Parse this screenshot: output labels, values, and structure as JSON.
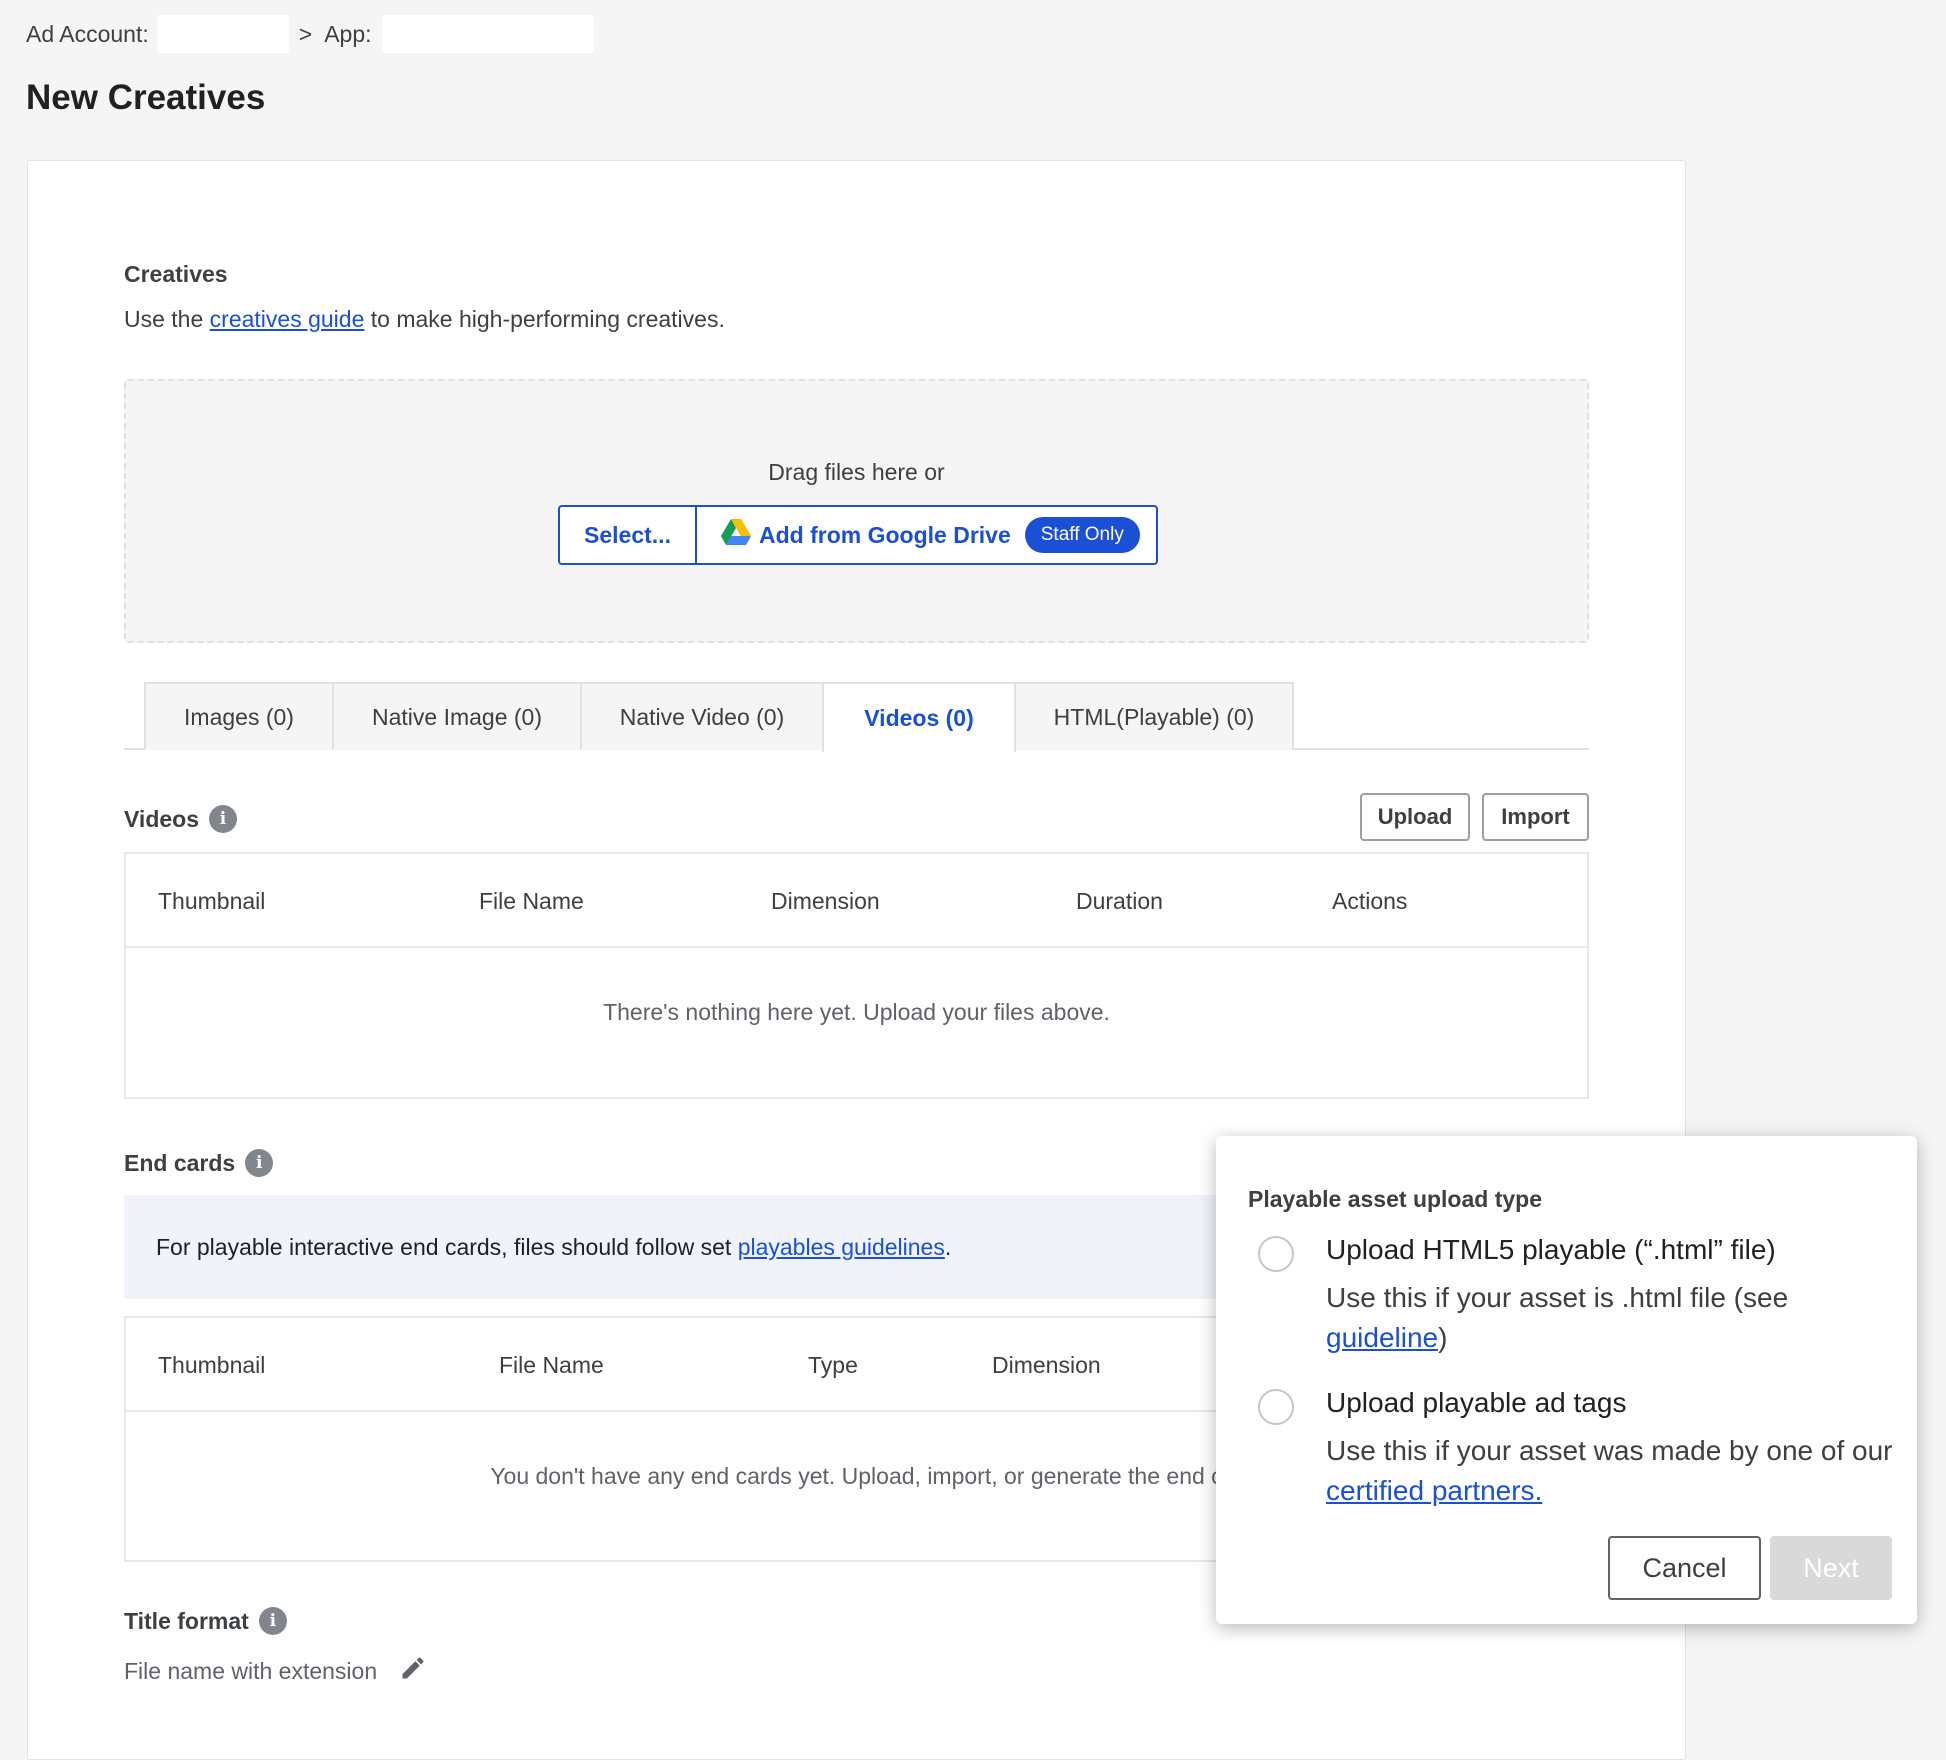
{
  "breadcrumb": {
    "ad_account_label": "Ad Account:",
    "separator": ">",
    "app_label": "App:"
  },
  "page_title": "New Creatives",
  "creatives": {
    "section_title": "Creatives",
    "helper_prefix": "Use the ",
    "helper_link": "creatives guide",
    "helper_suffix": " to make high-performing creatives."
  },
  "dropzone": {
    "text": "Drag files here or",
    "select_label": "Select...",
    "drive_label": "Add from Google Drive",
    "staff_badge": "Staff Only"
  },
  "tabs": [
    {
      "label": "Images (0)",
      "active": false
    },
    {
      "label": "Native Image (0)",
      "active": false
    },
    {
      "label": "Native Video (0)",
      "active": false
    },
    {
      "label": "Videos (0)",
      "active": true
    },
    {
      "label": "HTML(Playable) (0)",
      "active": false
    }
  ],
  "videos": {
    "title": "Videos",
    "upload_label": "Upload",
    "import_label": "Import",
    "columns": [
      "Thumbnail",
      "File Name",
      "Dimension",
      "Duration",
      "Actions"
    ],
    "empty_text": "There's nothing here yet. Upload your files above."
  },
  "end_cards": {
    "title": "End cards",
    "notice_prefix": "For playable interactive end cards, files should follow set ",
    "notice_link": "playables guidelines",
    "notice_suffix": ".",
    "columns": [
      "Thumbnail",
      "File Name",
      "Type",
      "Dimension"
    ],
    "empty_text": "You don't have any end cards yet. Upload, import, or generate the end c"
  },
  "title_format": {
    "title": "Title format",
    "value": "File name with extension"
  },
  "popover": {
    "title": "Playable asset upload type",
    "options": [
      {
        "label": "Upload HTML5 playable (“.html” file)",
        "desc_prefix": "Use this if your asset is .html file (see ",
        "desc_link": "guideline",
        "desc_suffix": ")",
        "selected": false
      },
      {
        "label": "Upload playable ad tags",
        "desc_prefix": "Use this if your asset was made by one of our ",
        "desc_link": "certified partners.",
        "desc_suffix": "",
        "selected": false
      }
    ],
    "cancel_label": "Cancel",
    "next_label": "Next"
  },
  "icons": [
    "info-icon",
    "google-drive-icon",
    "pencil-icon",
    "radio-unchecked-icon"
  ],
  "colors": {
    "accent": "#1a4fd6",
    "disabled_button": "#d9d9d9",
    "page_bg": "#f5f5f5"
  }
}
